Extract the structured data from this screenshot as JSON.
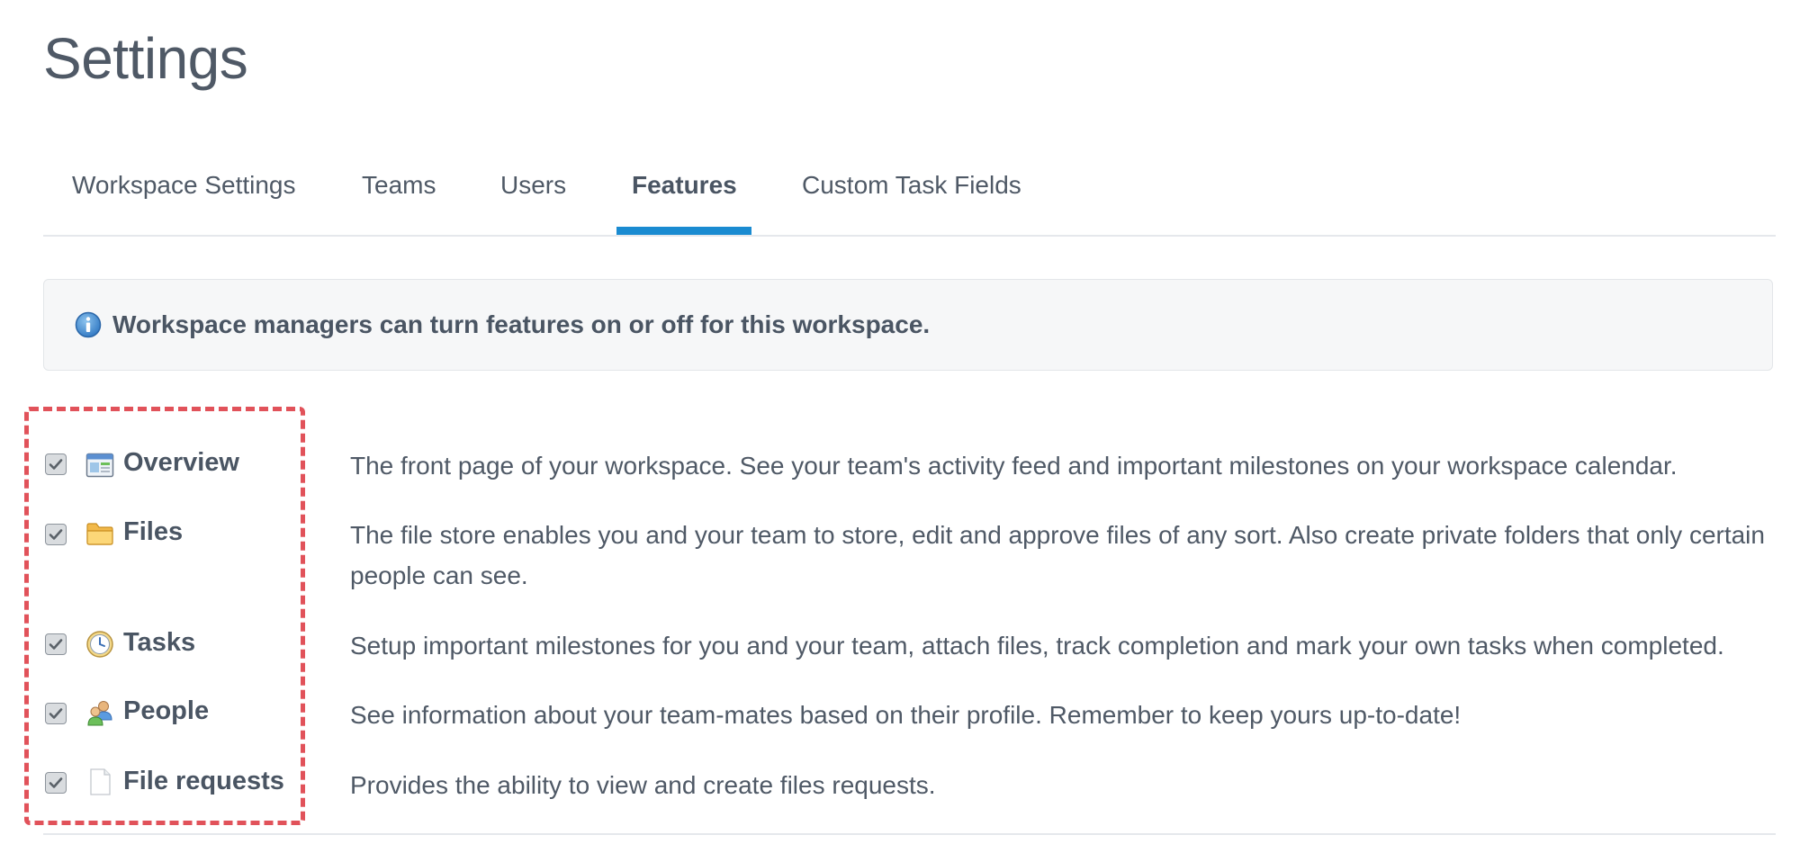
{
  "page": {
    "title": "Settings"
  },
  "tabs": [
    {
      "label": "Workspace Settings",
      "active": false
    },
    {
      "label": "Teams",
      "active": false
    },
    {
      "label": "Users",
      "active": false
    },
    {
      "label": "Features",
      "active": true
    },
    {
      "label": "Custom Task Fields",
      "active": false
    }
  ],
  "info": {
    "text": "Workspace managers can turn features on or off for this workspace.",
    "icon": "info-icon"
  },
  "features": [
    {
      "name": "Overview",
      "icon": "overview-icon",
      "checked": true,
      "description": "The front page of your workspace. See your team's activity feed and important milestones on your workspace calendar."
    },
    {
      "name": "Files",
      "icon": "folder-icon",
      "checked": true,
      "description": "The file store enables you and your team to store, edit and approve files of any sort. Also create private folders that only certain people can see."
    },
    {
      "name": "Tasks",
      "icon": "clock-icon",
      "checked": true,
      "description": "Setup important milestones for you and your team, attach files, track completion and mark your own tasks when completed."
    },
    {
      "name": "People",
      "icon": "people-icon",
      "checked": true,
      "description": "See information about your team-mates based on their profile. Remember to keep yours up-to-date!"
    },
    {
      "name": "File requests",
      "icon": "document-icon",
      "checked": true,
      "description": "Provides the ability to view and create files requests."
    }
  ],
  "colors": {
    "accent": "#1a8bd1",
    "highlight_border": "#e1525a",
    "text": "#4a5563"
  }
}
